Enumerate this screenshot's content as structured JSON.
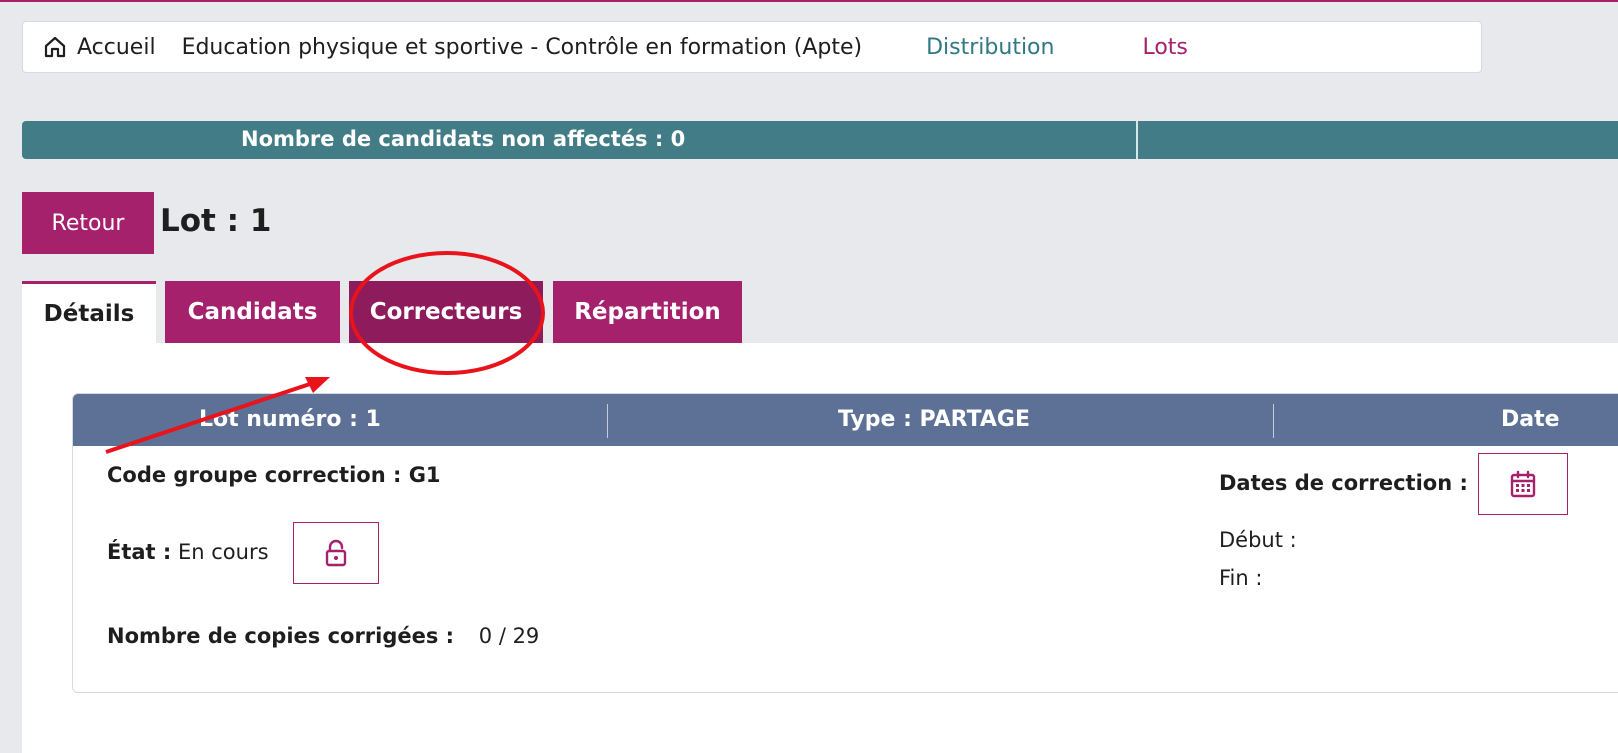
{
  "breadcrumb": {
    "home": "Accueil",
    "course": "Education physique et sportive - Contrôle en formation (Apte)",
    "distribution": "Distribution",
    "lots": "Lots"
  },
  "info_bar": {
    "text": "Nombre de candidats non affectés : 0"
  },
  "header": {
    "back_label": "Retour",
    "title": "Lot : 1"
  },
  "tabs": [
    {
      "label": "Détails",
      "active": true
    },
    {
      "label": "Candidats"
    },
    {
      "label": "Correcteurs"
    },
    {
      "label": "Répartition"
    }
  ],
  "card": {
    "header": {
      "col1": "Lot numéro : 1",
      "col2": "Type : PARTAGE",
      "col3": "Date"
    },
    "code_label": "Code groupe correction : G1",
    "etat_label": "État :",
    "etat_value": "En cours",
    "nb_label": "Nombre de copies corrigées :",
    "nb_value": "0 / 29",
    "dates_label": "Dates de correction :",
    "debut_label": "Début :",
    "fin_label": "Fin :"
  },
  "colors": {
    "accent": "#a5216c",
    "teal": "#427d87",
    "card_header": "#5c7195",
    "annotation": "#e8131b"
  },
  "icons": [
    "home-icon",
    "lock-open-icon",
    "calendar-icon"
  ]
}
